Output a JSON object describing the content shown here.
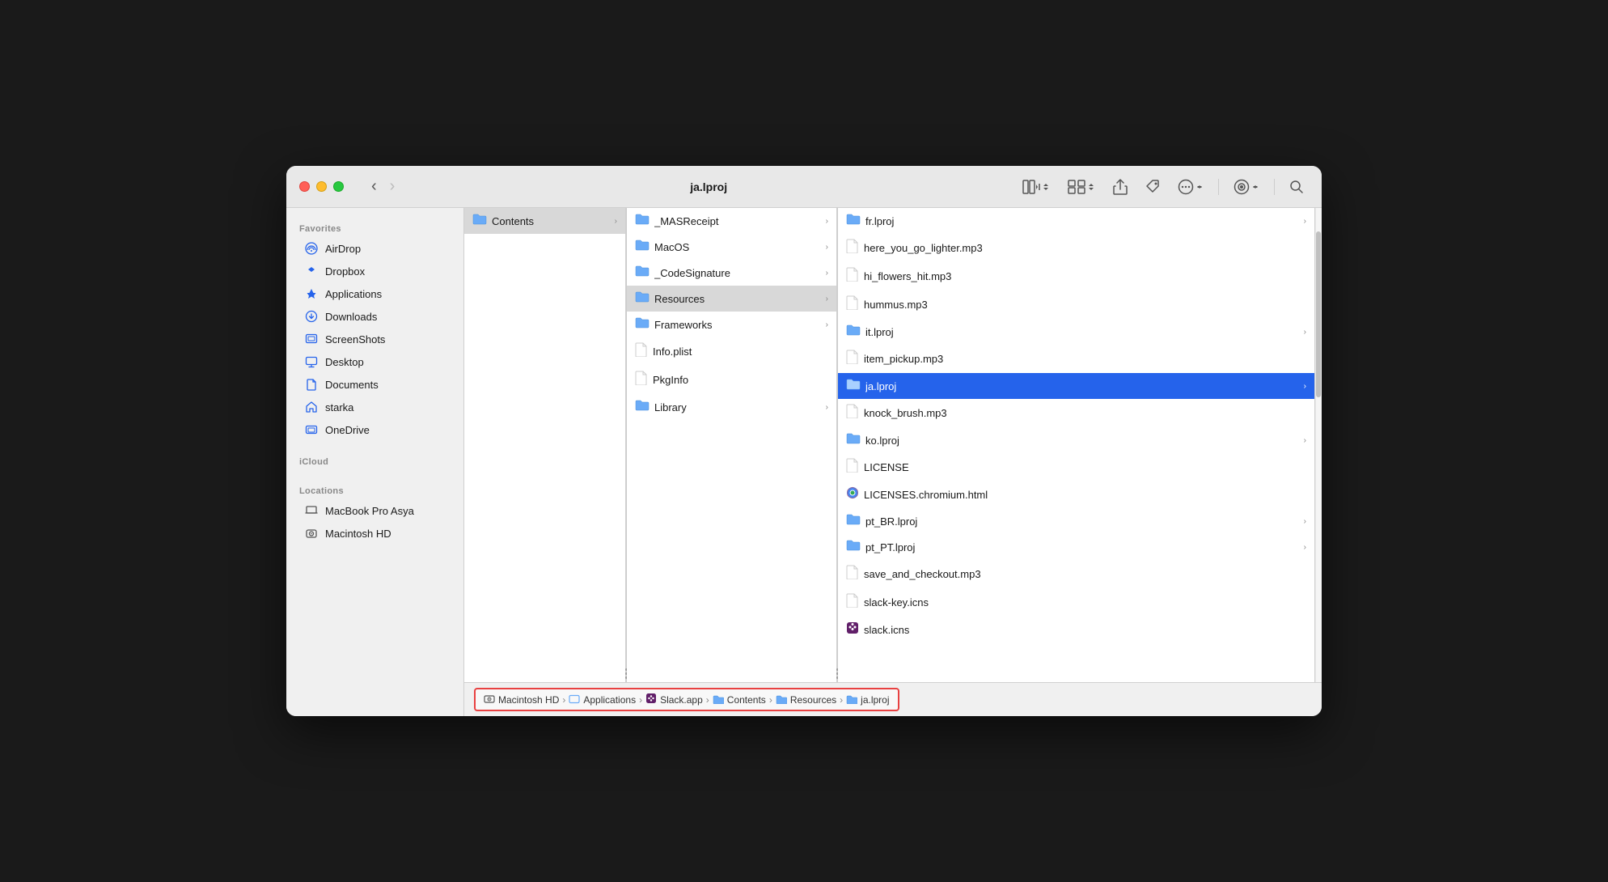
{
  "window": {
    "title": "ja.lproj",
    "traffic_lights": {
      "red": "close",
      "yellow": "minimize",
      "green": "maximize"
    }
  },
  "toolbar": {
    "back_label": "‹",
    "forward_label": "›",
    "title": "ja.lproj",
    "view_columns": "⊞",
    "view_grid_label": "⊞⊞",
    "share_label": "↑",
    "tag_label": "🏷",
    "more_label": "···",
    "view_options_label": "👁",
    "search_label": "🔍"
  },
  "sidebar": {
    "favorites_label": "Favorites",
    "items": [
      {
        "id": "airdrop",
        "label": "AirDrop",
        "icon": "📡"
      },
      {
        "id": "dropbox",
        "label": "Dropbox",
        "icon": "📦"
      },
      {
        "id": "applications",
        "label": "Applications",
        "icon": "🚀"
      },
      {
        "id": "downloads",
        "label": "Downloads",
        "icon": "⬇"
      },
      {
        "id": "screenshots",
        "label": "ScreenShots",
        "icon": "🗂"
      },
      {
        "id": "desktop",
        "label": "Desktop",
        "icon": "🖥"
      },
      {
        "id": "documents",
        "label": "Documents",
        "icon": "📄"
      },
      {
        "id": "starka",
        "label": "starka",
        "icon": "🏠"
      },
      {
        "id": "onedrive",
        "label": "OneDrive",
        "icon": "🗂"
      }
    ],
    "icloud_label": "iCloud",
    "locations_label": "Locations",
    "locations": [
      {
        "id": "macbook",
        "label": "MacBook Pro Asya",
        "icon": "💻"
      },
      {
        "id": "macintosh_hd",
        "label": "Macintosh HD",
        "icon": "💾"
      }
    ]
  },
  "columns": {
    "col1": {
      "items": [
        {
          "id": "contents",
          "label": "Contents",
          "has_arrow": true,
          "selected": false,
          "highlighted": true
        }
      ]
    },
    "col2": {
      "items": [
        {
          "id": "masreceipt",
          "label": "_MASReceipt",
          "has_arrow": true
        },
        {
          "id": "macos",
          "label": "MacOS",
          "has_arrow": true
        },
        {
          "id": "codesignature",
          "label": "_CodeSignature",
          "has_arrow": true
        },
        {
          "id": "resources",
          "label": "Resources",
          "has_arrow": true,
          "highlighted": true
        },
        {
          "id": "frameworks",
          "label": "Frameworks",
          "has_arrow": true
        },
        {
          "id": "info_plist",
          "label": "Info.plist",
          "has_arrow": false
        },
        {
          "id": "pkginfo",
          "label": "PkgInfo",
          "has_arrow": false
        },
        {
          "id": "library",
          "label": "Library",
          "has_arrow": true
        }
      ]
    },
    "col3": {
      "items": [
        {
          "id": "fr_lproj",
          "label": "fr.lproj",
          "has_arrow": true
        },
        {
          "id": "here_you_go",
          "label": "here_you_go_lighter.mp3",
          "has_arrow": false
        },
        {
          "id": "hi_flowers",
          "label": "hi_flowers_hit.mp3",
          "has_arrow": false
        },
        {
          "id": "hummus",
          "label": "hummus.mp3",
          "has_arrow": false
        },
        {
          "id": "it_lproj",
          "label": "it.lproj",
          "has_arrow": true
        },
        {
          "id": "item_pickup",
          "label": "item_pickup.mp3",
          "has_arrow": false
        },
        {
          "id": "ja_lproj",
          "label": "ja.lproj",
          "has_arrow": true,
          "selected": true
        },
        {
          "id": "knock_brush",
          "label": "knock_brush.mp3",
          "has_arrow": false
        },
        {
          "id": "ko_lproj",
          "label": "ko.lproj",
          "has_arrow": true
        },
        {
          "id": "license",
          "label": "LICENSE",
          "has_arrow": false
        },
        {
          "id": "licenses_chromium",
          "label": "LICENSES.chromium.html",
          "has_arrow": false
        },
        {
          "id": "pt_br_lproj",
          "label": "pt_BR.lproj",
          "has_arrow": true
        },
        {
          "id": "pt_pt_lproj",
          "label": "pt_PT.lproj",
          "has_arrow": true
        },
        {
          "id": "save_checkout",
          "label": "save_and_checkout.mp3",
          "has_arrow": false
        },
        {
          "id": "slack_key_icns",
          "label": "slack-key.icns",
          "has_arrow": false
        },
        {
          "id": "slack_icns",
          "label": "slack.icns",
          "has_arrow": false
        }
      ]
    }
  },
  "breadcrumb": {
    "items": [
      {
        "id": "macintosh_hd",
        "label": "Macintosh HD",
        "icon": "💾"
      },
      {
        "id": "applications",
        "label": "Applications",
        "icon": "🗂"
      },
      {
        "id": "slack_app",
        "label": "Slack.app",
        "icon": "🟣"
      },
      {
        "id": "contents",
        "label": "Contents",
        "icon": "🗂"
      },
      {
        "id": "resources",
        "label": "Resources",
        "icon": "🗂"
      },
      {
        "id": "ja_lproj",
        "label": "ja.lproj",
        "icon": "🗂"
      }
    ]
  }
}
